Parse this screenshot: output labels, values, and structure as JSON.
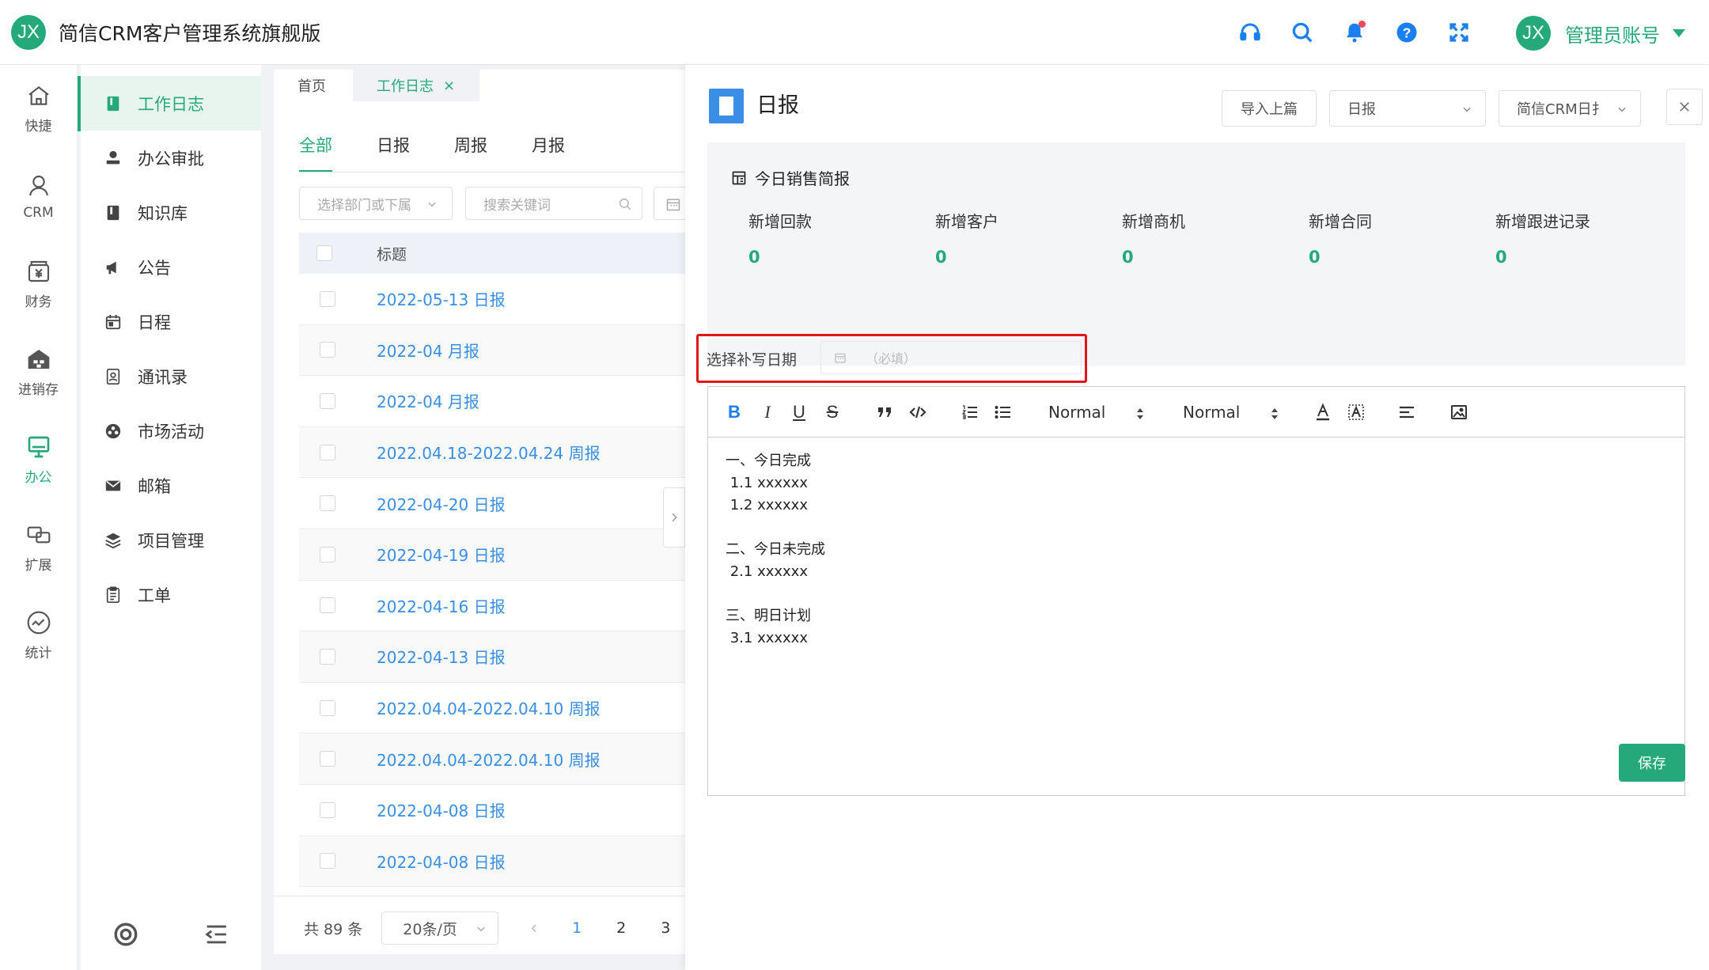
{
  "app": {
    "logo_text": "JX",
    "title": "简信CRM客户管理系统旗舰版"
  },
  "header": {
    "icons": [
      "headset-icon",
      "search-icon",
      "bell-icon",
      "help-icon",
      "fullscreen-icon"
    ],
    "user": {
      "avatar_text": "JX",
      "name": "管理员账号"
    }
  },
  "leftnav": {
    "items": [
      {
        "label": "快捷",
        "icon": "home-icon"
      },
      {
        "label": "CRM",
        "icon": "user-icon"
      },
      {
        "label": "财务",
        "icon": "finance-icon"
      },
      {
        "label": "进销存",
        "icon": "warehouse-icon"
      },
      {
        "label": "办公",
        "icon": "monitor-icon",
        "active": true
      },
      {
        "label": "扩展",
        "icon": "extend-icon"
      },
      {
        "label": "统计",
        "icon": "stats-icon"
      }
    ]
  },
  "submenu": {
    "items": [
      {
        "label": "工作日志",
        "active": true
      },
      {
        "label": "办公审批"
      },
      {
        "label": "知识库"
      },
      {
        "label": "公告"
      },
      {
        "label": "日程"
      },
      {
        "label": "通讯录"
      },
      {
        "label": "市场活动"
      },
      {
        "label": "邮箱"
      },
      {
        "label": "项目管理"
      },
      {
        "label": "工单"
      }
    ]
  },
  "page_tabs": {
    "home": "首页",
    "current": "工作日志",
    "close": "×"
  },
  "list": {
    "filter_tabs": [
      "全部",
      "日报",
      "周报",
      "月报"
    ],
    "dept_placeholder": "选择部门或下属",
    "search_placeholder": "搜索关键词",
    "column_title": "标题",
    "rows": [
      "2022-05-13 日报",
      "2022-04 月报",
      "2022-04 月报",
      "2022.04.18-2022.04.24 周报",
      "2022-04-20 日报",
      "2022-04-19 日报",
      "2022-04-16 日报",
      "2022-04-13 日报",
      "2022.04.04-2022.04.10 周报",
      "2022.04.04-2022.04.10 周报",
      "2022-04-08 日报",
      "2022-04-08 日报"
    ],
    "pager": {
      "total": "共 89 条",
      "per_page": "20条/页",
      "prev": "‹",
      "pages": [
        "1",
        "2",
        "3"
      ],
      "current": "1"
    }
  },
  "detail": {
    "title": "日报",
    "import_btn": "导入上篇",
    "type_select": "日报",
    "template_select": "简信CRM日扌",
    "summary": {
      "title": "今日销售简报",
      "stats": [
        {
          "label": "新增回款",
          "value": "0"
        },
        {
          "label": "新增客户",
          "value": "0"
        },
        {
          "label": "新增商机",
          "value": "0"
        },
        {
          "label": "新增合同",
          "value": "0"
        },
        {
          "label": "新增跟进记录",
          "value": "0"
        }
      ]
    },
    "date_label": "选择补写日期",
    "date_placeholder": "（必填）",
    "toolbar": {
      "header_select": "Normal",
      "size_select": "Normal"
    },
    "content": [
      "一、今日完成",
      " 1.1 xxxxxx",
      " 1.2 xxxxxx",
      "",
      "二、今日未完成",
      " 2.1 xxxxxx",
      "",
      "三、明日计划",
      " 3.1 xxxxxx"
    ],
    "save_btn": "保存"
  },
  "colors": {
    "accent": "#26a97a",
    "link": "#3a8ee6",
    "highlight": "#e3141a"
  }
}
